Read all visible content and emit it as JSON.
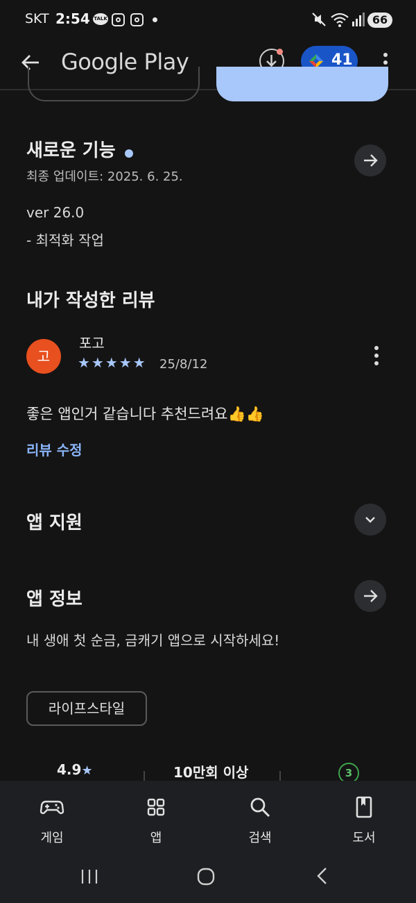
{
  "status_bar": {
    "carrier": "SKT",
    "time": "2:54",
    "talk_badge": "TALK",
    "battery": "66"
  },
  "app_bar": {
    "title": "Google Play",
    "points": "41"
  },
  "whats_new": {
    "title": "새로운 기능",
    "updated": "최종 업데이트: 2025. 6. 25.",
    "version": "ver 26.0",
    "notes": "- 최적화 작업"
  },
  "my_review": {
    "title": "내가 작성한 리뷰",
    "avatar_initial": "고",
    "author": "포고",
    "rating": 5,
    "stars": "★★★★★",
    "date": "25/8/12",
    "text": "좋은 앱인거 같습니다 추천드려요👍👍",
    "edit_link": "리뷰 수정"
  },
  "app_support": {
    "title": "앱 지원"
  },
  "app_info": {
    "title": "앱 정보",
    "description": "내 생애 첫 순금, 금캐기 앱으로 시작하세요!",
    "category": "라이프스타일"
  },
  "stats": {
    "rating": "4.9",
    "rating_star": "★",
    "downloads": "10만회 이상",
    "age_rating": "3"
  },
  "bottom_nav": {
    "items": [
      {
        "label": "게임",
        "icon": "gamepad-icon"
      },
      {
        "label": "앱",
        "icon": "apps-grid-icon"
      },
      {
        "label": "검색",
        "icon": "search-icon"
      },
      {
        "label": "도서",
        "icon": "book-icon"
      }
    ]
  },
  "colors": {
    "background": "#141414",
    "accent_blue": "#a8c7fa",
    "link_blue": "#8ab4f8",
    "points_pill": "#1a55c8",
    "avatar": "#e8501f",
    "age_green": "#3fa34d"
  }
}
